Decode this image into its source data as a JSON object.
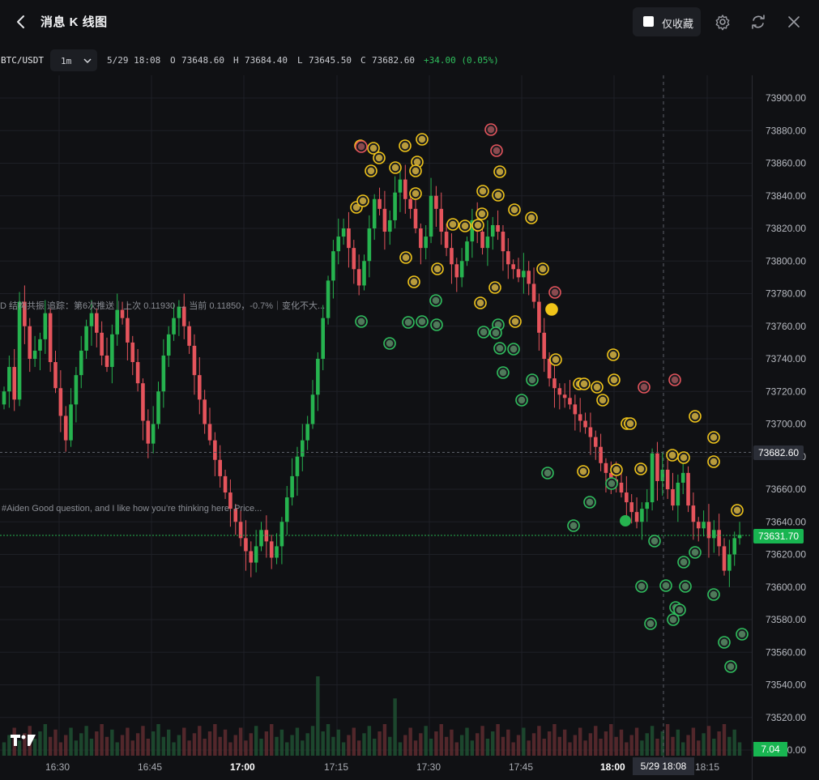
{
  "header": {
    "title": "消息 K 线图",
    "favorites_only_label": "仅收藏"
  },
  "info_bar": {
    "symbol": "BTC/USDT",
    "timeframe": "1m",
    "time": "5/29 18:08",
    "open_label": "O",
    "open": "73648.60",
    "high_label": "H",
    "high": "73684.40",
    "low_label": "L",
    "low": "73645.50",
    "close_label": "C",
    "close": "73682.60",
    "change": "+34.00 (0.05%)"
  },
  "price_axis": {
    "ticks": [
      "73900.00",
      "73880.00",
      "73860.00",
      "73840.00",
      "73820.00",
      "73800.00",
      "73780.00",
      "73760.00",
      "73740.00",
      "73720.00",
      "73700.00",
      "73680.00",
      "73660.00",
      "73640.00",
      "73620.00",
      "73600.00",
      "73580.00",
      "73560.00",
      "73540.00",
      "73520.00",
      "73500.00"
    ],
    "last_price": "73682.60",
    "current_price": "73631.70",
    "volume_value": "7.04"
  },
  "time_axis": {
    "ticks": [
      "16:30",
      "16:45",
      "17:00",
      "17:15",
      "17:30",
      "17:45",
      "18:00",
      "18:15"
    ],
    "crosshair": "5/29 18:08"
  },
  "annotations": [
    "D 结构共振 追踪：第6次推送｜上次 0.11930 → 当前 0.11850，-0.7%｜变化不大...",
    "#Aiden Good question, and I like how you're thinking here. Price..."
  ],
  "colors": {
    "up": "#26b34f",
    "down": "#e5545c",
    "accent_yellow": "#f0c419",
    "background": "#101114"
  },
  "chart_data": {
    "type": "candlestick",
    "symbol": "BTC/USDT",
    "interval": "1m",
    "ylim": [
      73500,
      73900
    ],
    "x_ticks": [
      "16:30",
      "16:45",
      "17:00",
      "17:15",
      "17:30",
      "17:45",
      "18:00",
      "18:15"
    ],
    "last": {
      "time": "5/29 18:08",
      "open": 73648.6,
      "high": 73684.4,
      "low": 73645.5,
      "close": 73682.6
    },
    "closes": [
      73720,
      73735,
      73715,
      73775,
      73760,
      73740,
      73745,
      73752,
      73768,
      73738,
      73722,
      73705,
      73690,
      73712,
      73730,
      73745,
      73760,
      73768,
      73756,
      73742,
      73735,
      73755,
      73770,
      73765,
      73750,
      73738,
      73725,
      73702,
      73688,
      73700,
      73720,
      73742,
      73755,
      73765,
      73772,
      73760,
      73748,
      73730,
      73715,
      73700,
      73690,
      73678,
      73668,
      73658,
      73648,
      73640,
      73630,
      73622,
      73615,
      73625,
      73635,
      73628,
      73618,
      73625,
      73640,
      73655,
      73668,
      73680,
      73690,
      73700,
      73718,
      73740,
      73765,
      73788,
      73806,
      73815,
      73820,
      73808,
      73795,
      73785,
      73800,
      73820,
      73838,
      73832,
      73818,
      73825,
      73842,
      73850,
      73838,
      73832,
      73820,
      73808,
      73815,
      73840,
      73832,
      73818,
      73808,
      73798,
      73790,
      73800,
      73812,
      73825,
      73818,
      73808,
      73815,
      73822,
      73818,
      73806,
      73798,
      73795,
      73790,
      73794,
      73786,
      73775,
      73756,
      73740,
      73728,
      73722,
      73718,
      73716,
      73712,
      73706,
      73702,
      73698,
      73692,
      73686,
      73676,
      73670,
      73666,
      73664,
      73658,
      73652,
      73646,
      73640,
      73648,
      73652,
      73682,
      73665,
      73672,
      73660,
      73650,
      73664,
      73670,
      73650,
      73640,
      73636,
      73640,
      73630,
      73635,
      73625,
      73610,
      73620,
      73630,
      73632
    ],
    "volume_max": 7.04
  }
}
